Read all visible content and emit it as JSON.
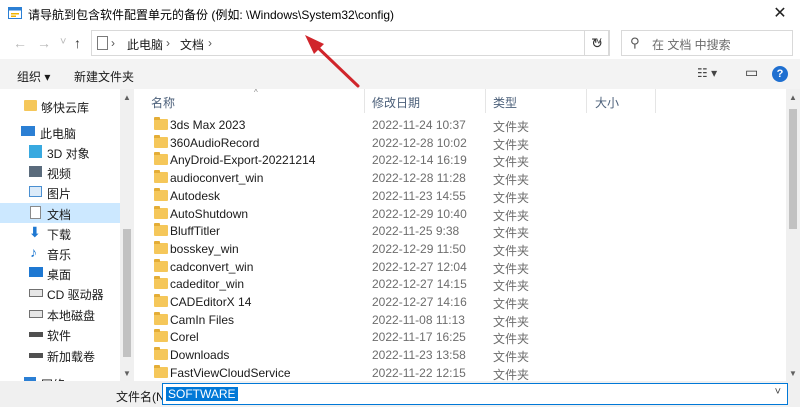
{
  "window": {
    "title": "请导航到包含软件配置单元的备份 (例如: \\Windows\\System32\\config)",
    "close_glyph": "✕"
  },
  "address_bar": {
    "back_glyph": "←",
    "forward_glyph": "→",
    "recent_glyph": "˅",
    "up_glyph": "↑",
    "separator_glyph": "›",
    "path": [
      "此电脑",
      "文档"
    ],
    "dropdown_glyph": "˅",
    "refresh_glyph": "↻",
    "search_placeholder": "在 文档 中搜索"
  },
  "toolbar": {
    "organize": "组织 ▾",
    "new_folder": "新建文件夹",
    "view_glyph": "☷ ▾",
    "pane_glyph": "▭",
    "help_glyph": "?"
  },
  "sidebar": {
    "items": [
      {
        "label": "够快云库",
        "icon": "folder-icon",
        "color": "#f5c75a"
      },
      {
        "label": "此电脑",
        "icon": "computer-icon",
        "color": "#2b7fd4"
      },
      {
        "label": "3D 对象",
        "icon": "3d-objects-icon",
        "color": "#38a9e0"
      },
      {
        "label": "视频",
        "icon": "video-icon",
        "color": "#5a6b7c"
      },
      {
        "label": "图片",
        "icon": "pictures-icon",
        "color": "#4a8fd1"
      },
      {
        "label": "文档",
        "icon": "documents-icon",
        "color": "#8a8a8a"
      },
      {
        "label": "下载",
        "icon": "download-icon",
        "color": "#1e78d2"
      },
      {
        "label": "音乐",
        "icon": "music-icon",
        "color": "#1e78d2"
      },
      {
        "label": "桌面",
        "icon": "desktop-icon",
        "color": "#1e78d2"
      },
      {
        "label": "CD 驱动器",
        "icon": "cd-drive-icon",
        "color": "#707070"
      },
      {
        "label": "本地磁盘",
        "icon": "local-disk-icon",
        "color": "#707070"
      },
      {
        "label": "软件",
        "icon": "drive-icon",
        "color": "#505050"
      },
      {
        "label": "新加载卷",
        "icon": "drive-icon",
        "color": "#505050"
      },
      {
        "label": "网络",
        "icon": "network-icon",
        "color": "#2b7fd4"
      }
    ],
    "selected": "文档"
  },
  "file_list": {
    "columns": [
      "名称",
      "修改日期",
      "类型",
      "大小"
    ],
    "rows": [
      {
        "name": "3ds Max 2023",
        "date": "2022-11-24 10:37",
        "type": "文件夹"
      },
      {
        "name": "360AudioRecord",
        "date": "2022-12-28 10:02",
        "type": "文件夹"
      },
      {
        "name": "AnyDroid-Export-20221214",
        "date": "2022-12-14 16:19",
        "type": "文件夹"
      },
      {
        "name": "audioconvert_win",
        "date": "2022-12-28 11:28",
        "type": "文件夹"
      },
      {
        "name": "Autodesk",
        "date": "2022-11-23 14:55",
        "type": "文件夹"
      },
      {
        "name": "AutoShutdown",
        "date": "2022-12-29 10:40",
        "type": "文件夹"
      },
      {
        "name": "BluffTitler",
        "date": "2022-11-25 9:38",
        "type": "文件夹"
      },
      {
        "name": "bosskey_win",
        "date": "2022-12-29 11:50",
        "type": "文件夹"
      },
      {
        "name": "cadconvert_win",
        "date": "2022-12-27 12:04",
        "type": "文件夹"
      },
      {
        "name": "cadeditor_win",
        "date": "2022-12-27 14:15",
        "type": "文件夹"
      },
      {
        "name": "CADEditorX 14",
        "date": "2022-12-27 14:16",
        "type": "文件夹"
      },
      {
        "name": "CamIn Files",
        "date": "2022-11-08 11:13",
        "type": "文件夹"
      },
      {
        "name": "Corel",
        "date": "2022-11-17 16:25",
        "type": "文件夹"
      },
      {
        "name": "Downloads",
        "date": "2022-11-23 13:58",
        "type": "文件夹"
      },
      {
        "name": "FastViewCloudService",
        "date": "2022-11-22 12:15",
        "type": "文件夹"
      }
    ]
  },
  "filename": {
    "label": "文件名(N):",
    "value": "SOFTWARE",
    "dropdown_glyph": "˅"
  },
  "colors": {
    "accent": "#0078d7",
    "selected_bg": "#cce8ff",
    "annotation_arrow": "#d0252b"
  }
}
